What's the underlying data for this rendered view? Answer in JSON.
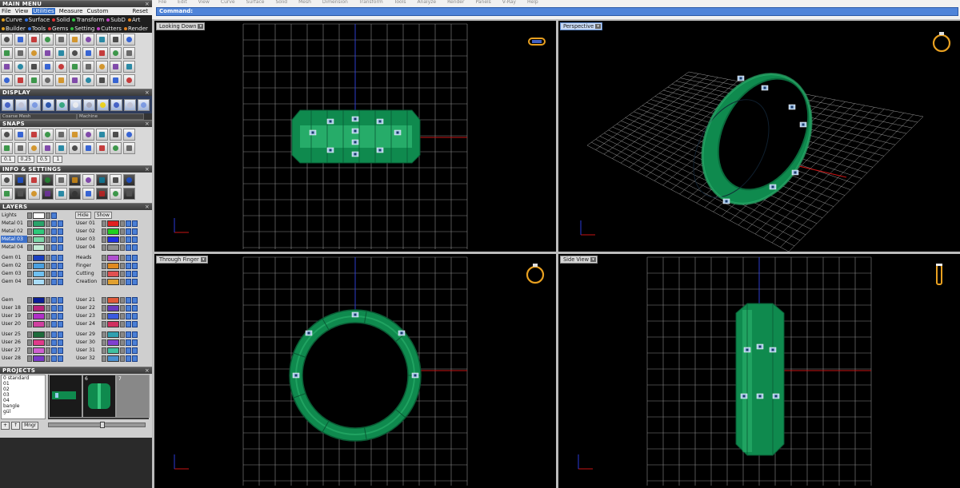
{
  "panels": {
    "main_menu": "MAIN MENU",
    "display": "DISPLAY",
    "snaps": "SNAPS",
    "info": "INFO & SETTINGS",
    "layers": "LAYERS",
    "projects": "PROJECTS",
    "close_glyph": "×"
  },
  "menu": {
    "items": [
      "File",
      "View",
      "Utilities",
      "Measure",
      "Custom"
    ],
    "reset": "Reset"
  },
  "tabs_row1": [
    "Curve",
    "Surface",
    "Solid",
    "Transform",
    "SubD",
    "Art"
  ],
  "tabs_row2": [
    "Builder",
    "Tools",
    "Gems",
    "Setting",
    "Cutters",
    "Render"
  ],
  "display": {
    "mesh_select": "Coarse Mesh",
    "machine_select": "Machine"
  },
  "snap_values": [
    "0.1",
    "0.25",
    "0.5",
    "1"
  ],
  "layers": {
    "hide_label": "Hide",
    "show_label": "Show",
    "lights": "Lights",
    "left": [
      {
        "name": "Metal 01",
        "color": "#2aa36a"
      },
      {
        "name": "Metal 02",
        "color": "#2dc97a"
      },
      {
        "name": "Metal 03",
        "color": "#7ad8a8",
        "active": true
      },
      {
        "name": "Metal 04",
        "color": "#c4ecd6"
      },
      {
        "name": "Gem 01",
        "color": "#1a3fbf"
      },
      {
        "name": "Gem 02",
        "color": "#4aa0e0"
      },
      {
        "name": "Gem 03",
        "color": "#6fc0f0"
      },
      {
        "name": "Gem 04",
        "color": "#a8dcf8"
      },
      {
        "name": "Gem",
        "color": "#0b1e96"
      },
      {
        "name": "User 18",
        "color": "#b7247c"
      },
      {
        "name": "User 19",
        "color": "#b030c8"
      },
      {
        "name": "User 20",
        "color": "#d040a0"
      },
      {
        "name": "User 25",
        "color": "#1e6b3c"
      },
      {
        "name": "User 26",
        "color": "#e03a8a"
      },
      {
        "name": "User 27",
        "color": "#d060d0"
      },
      {
        "name": "User 28",
        "color": "#7a3ac8"
      }
    ],
    "right": [
      {
        "name": "User 01",
        "color": "#e02020"
      },
      {
        "name": "User 02",
        "color": "#20d020"
      },
      {
        "name": "User 03",
        "color": "#2030e0"
      },
      {
        "name": "User 04",
        "color": "#909090"
      },
      {
        "name": "Heads",
        "color": "#b050d0"
      },
      {
        "name": "Finger",
        "color": "#e08a20"
      },
      {
        "name": "Cutting",
        "color": "#e05050"
      },
      {
        "name": "Creation",
        "color": "#e0a030"
      },
      {
        "name": "User 21",
        "color": "#e05a3a"
      },
      {
        "name": "User 22",
        "color": "#6a3ac0"
      },
      {
        "name": "User 23",
        "color": "#3a5ae0"
      },
      {
        "name": "User 24",
        "color": "#d03060"
      },
      {
        "name": "User 29",
        "color": "#30a0b0"
      },
      {
        "name": "User 30",
        "color": "#8040d0"
      },
      {
        "name": "User 31",
        "color": "#40c0a0"
      },
      {
        "name": "User 32",
        "color": "#4a90d0"
      }
    ]
  },
  "projects": {
    "list": [
      "0 standard",
      "01",
      "02",
      "03",
      "04",
      "bangle",
      "gül"
    ],
    "thumb_numbers": [
      "6",
      "7"
    ],
    "buttons": [
      "+",
      "↑",
      "Mngr"
    ]
  },
  "topbar": {
    "menus": [
      "File",
      "Edit",
      "View",
      "Curve",
      "Surface",
      "Solid",
      "Mesh",
      "Dimension",
      "Transform",
      "Tools",
      "Analyze",
      "Render",
      "Panels",
      "V-Ray",
      "Help"
    ],
    "command": "Command:"
  },
  "viewports": {
    "tl": "Looking Down",
    "tr": "Perspective",
    "bl": "Through Finger",
    "br": "Side View",
    "dropdown_glyph": "▾"
  },
  "colors": {
    "ring": "#0f8a4e",
    "ring_dark": "#0a5a34",
    "ring_light": "#3ac980",
    "grid": "#8a8a8a",
    "x_axis": "#c81414",
    "y_axis": "#2a3ad8",
    "active_layer": "#3b6fc9"
  }
}
